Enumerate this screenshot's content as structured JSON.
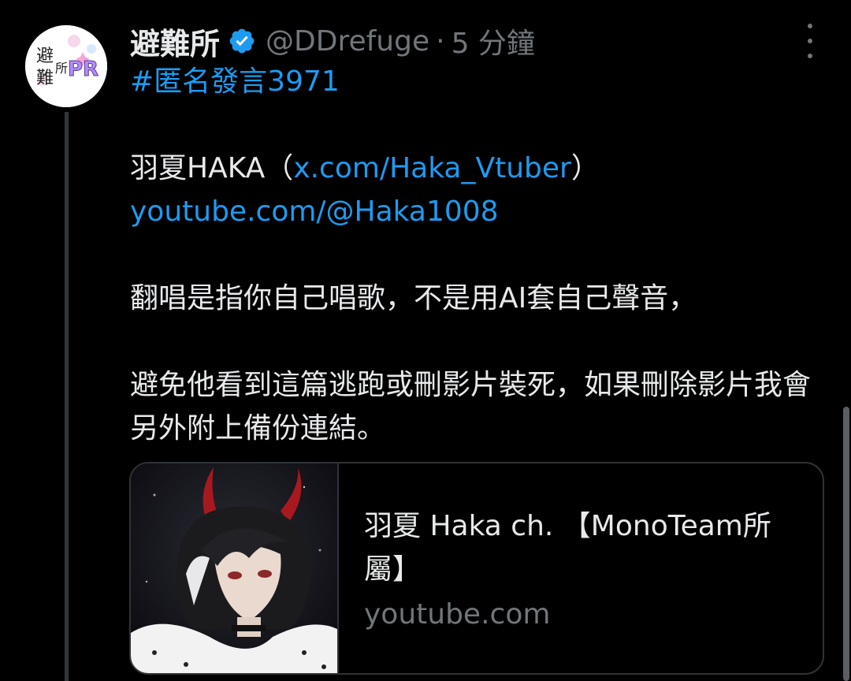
{
  "author": {
    "display_name": "避難所",
    "handle": "@DDrefuge",
    "separator": "·",
    "time": "5 分鐘",
    "avatar_text": [
      "避",
      "難",
      "所",
      "PR"
    ]
  },
  "tweet": {
    "hashtag": "#匿名發言3971",
    "name_line_prefix": "羽夏HAKA（",
    "name_line_link": "x.com/Haka_Vtuber",
    "name_line_suffix": "）",
    "youtube_link": "youtube.com/@Haka1008",
    "paragraph_1": "翻唱是指你自己唱歌，不是用AI套自己聲音，",
    "paragraph_2": "避免他看到這篇逃跑或刪影片裝死，如果刪除影片我會另外附上備份連結。"
  },
  "card": {
    "title": "羽夏 Haka ch. 【MonoTeam所屬】",
    "domain": "youtube.com"
  },
  "icons": {
    "verified": "verified-badge-icon",
    "more": "more-options-icon"
  },
  "colors": {
    "background": "#000000",
    "text": "#e7e9ea",
    "secondary": "#71767b",
    "link": "#1d9bf0",
    "border": "#2f3336"
  }
}
